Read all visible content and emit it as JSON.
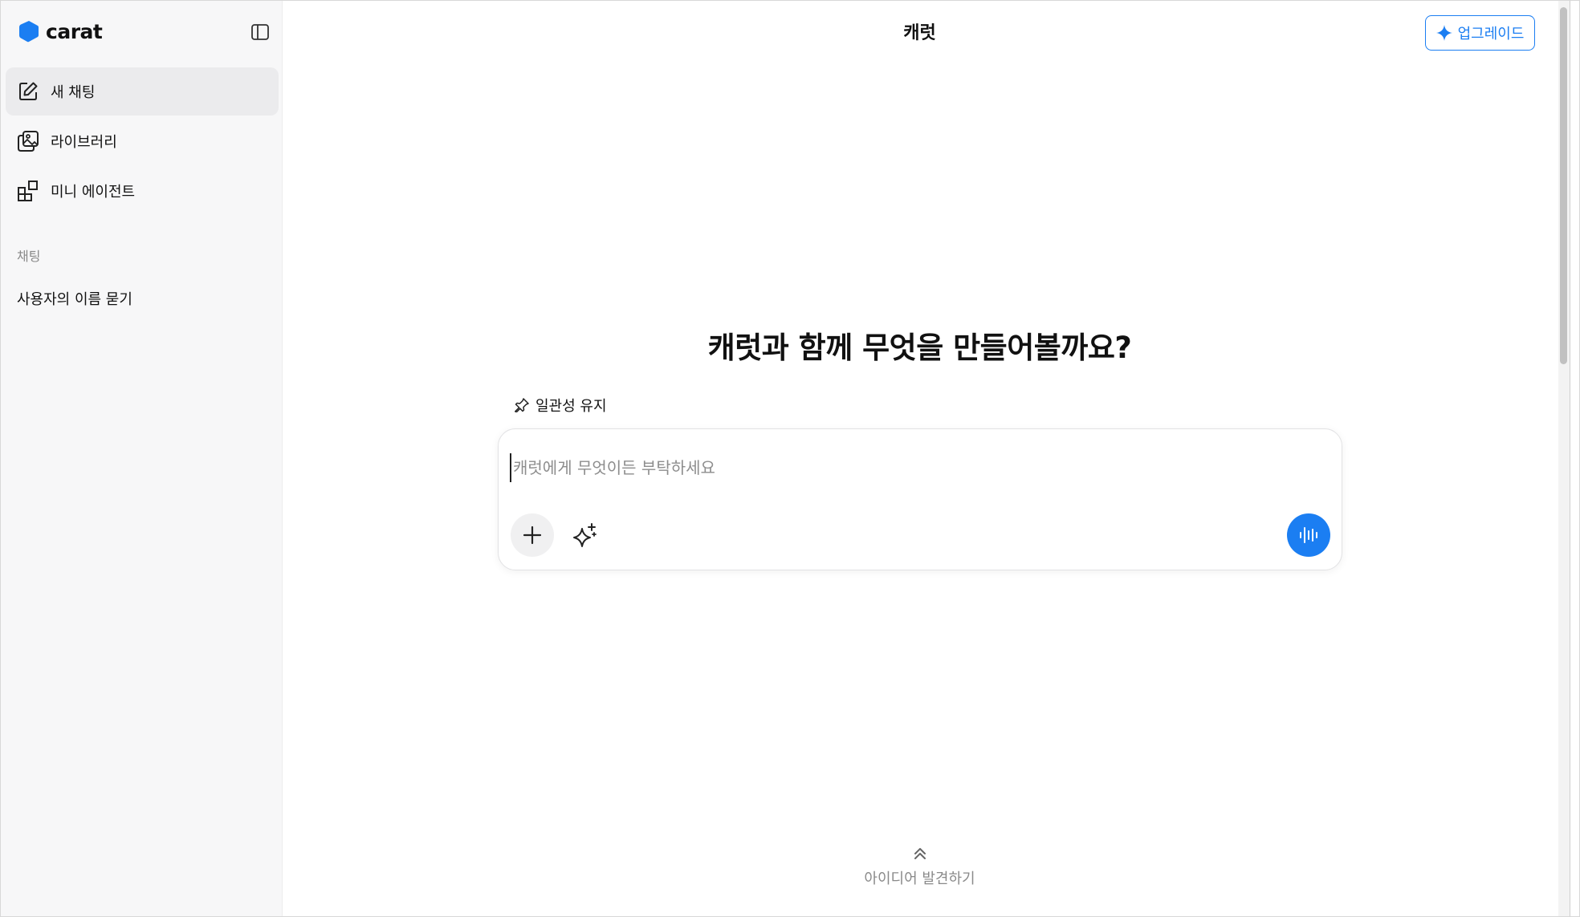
{
  "brand": {
    "name": "carat",
    "logo_color": "#1b7ef2"
  },
  "sidebar": {
    "toggle_icon": "sidebar-toggle-icon",
    "items": [
      {
        "label": "새 채팅",
        "icon": "edit-icon",
        "active": true
      },
      {
        "label": "라이브러리",
        "icon": "gallery-icon",
        "active": false
      },
      {
        "label": "미니 에이전트",
        "icon": "widgets-icon",
        "active": false
      }
    ],
    "section_label": "채팅",
    "chats": [
      {
        "label": "사용자의 이름 묻기"
      }
    ]
  },
  "header": {
    "title": "캐럿",
    "upgrade_label": "업그레이드",
    "accent_color": "#1b7ef2"
  },
  "main": {
    "hero_title": "캐럿과 함께 무엇을 만들어볼까요?",
    "pin_label": "일관성 유지",
    "composer": {
      "placeholder": "캐럿에게 무엇이든 부탁하세요",
      "value": ""
    },
    "discover_label": "아이디어 발견하기"
  }
}
